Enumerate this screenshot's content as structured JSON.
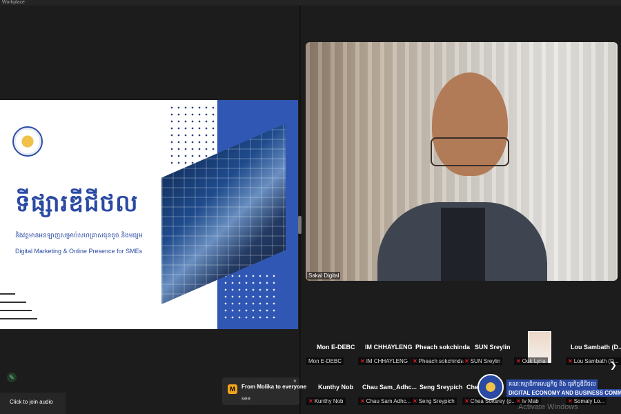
{
  "window": {
    "tab_title": "Workplace"
  },
  "slide": {
    "khmer_title": "ទីផ្សារឌីជីថល",
    "khmer_subtitle": "និងវត្តមានអនឡាញសម្រាប់សហគ្រាសធុនតូច និងមធ្យម",
    "english_subtitle": "Digital Marketing & Online Presence for SMEs"
  },
  "video": {
    "speaker_label": "Sakal Digital"
  },
  "participants_row1": [
    {
      "name": "Mon E-DEBC",
      "label": "Mon E-DEBC",
      "muted": false
    },
    {
      "name": "IM CHHAYLENG",
      "label": "IM CHHAYLENG",
      "muted": true
    },
    {
      "name": "Pheach sokchinda",
      "label": "Pheach sokchinda",
      "muted": true
    },
    {
      "name": "SUN Sreylin",
      "label": "SUN Sreylin",
      "muted": true
    },
    {
      "name": "",
      "label": "Ouk Lyna",
      "muted": true
    },
    {
      "name": "Lou Sambath (D...",
      "label": "Lou Sambath (D...",
      "muted": true
    }
  ],
  "participants_row2": [
    {
      "name": "Kunthy Nob",
      "label": "Kunthy Nob",
      "muted": true
    },
    {
      "name": "Chau Sam_Adhc...",
      "label": "Chau Sam Adhc...",
      "muted": true
    },
    {
      "name": "Seng Sreypich",
      "label": "Seng Sreypich",
      "muted": true
    },
    {
      "name": "Chea",
      "label": "Chea Soksrey (p...",
      "muted": true
    },
    {
      "name": "",
      "label": "Iv Mab",
      "muted": true
    },
    {
      "name": "",
      "label": "Somaly Lo...",
      "muted": true
    }
  ],
  "notification": {
    "avatar_letter": "M",
    "from": "From Molika to everyone",
    "message": "see",
    "close": "×"
  },
  "join_audio": "Click to join audio",
  "banner": {
    "khmer": "គណៈកម្មាធិការសេដ្ឋកិច្ច និង ធុរកិច្ចឌីជីថល",
    "english": "DIGITAL ECONOMY AND BUSINESS COMMITTEE"
  },
  "watermark": "Activate Windows",
  "colors": {
    "brand_blue": "#2b4aa3",
    "panel_blue": "#3057b3",
    "muted_red": "#e02020",
    "notif_badge": "#f0a41d"
  }
}
